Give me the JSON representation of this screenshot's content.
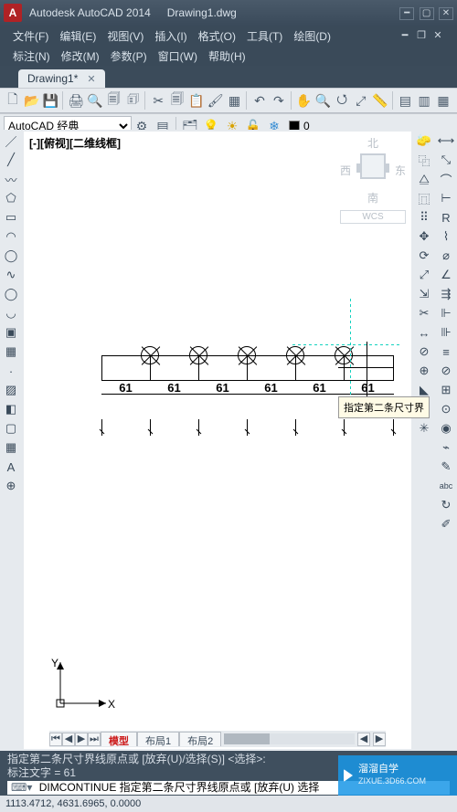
{
  "titlebar": {
    "logo": "A",
    "app": "Autodesk AutoCAD 2014",
    "doc": "Drawing1.dwg"
  },
  "menu": {
    "row1": [
      "文件(F)",
      "编辑(E)",
      "视图(V)",
      "插入(I)",
      "格式(O)",
      "工具(T)",
      "绘图(D)"
    ],
    "row2": [
      "标注(N)",
      "修改(M)",
      "参数(P)",
      "窗口(W)",
      "帮助(H)"
    ]
  },
  "doctab": {
    "label": "Drawing1*"
  },
  "workspace": {
    "value": "AutoCAD 经典"
  },
  "layer": {
    "value": "0"
  },
  "viewport_label": "[-][俯视][二维线框]",
  "viewcube": {
    "n": "北",
    "s": "南",
    "e": "东",
    "w": "西",
    "wcs": "WCS"
  },
  "dimension": {
    "value": "61",
    "count": 6
  },
  "tooltip": "指定第二条尺寸界",
  "ucs": {
    "x": "X",
    "y": "Y"
  },
  "layouttabs": {
    "active": "模型",
    "tabs": [
      "布局1",
      "布局2"
    ]
  },
  "command": {
    "hist1": "指定第二条尺寸界线原点或 [放弃(U)/选择(S)] <选择>:",
    "hist2": "标注文字 = 61",
    "prompt": "DIMCONTINUE 指定第二条尺寸界线原点或 [放弃(U) 选择"
  },
  "status": {
    "coords": "1113.4712, 4631.6965, 0.0000"
  },
  "watermark": {
    "line1": "溜溜自学",
    "line2": "ZIXUE.3D66.COM"
  }
}
